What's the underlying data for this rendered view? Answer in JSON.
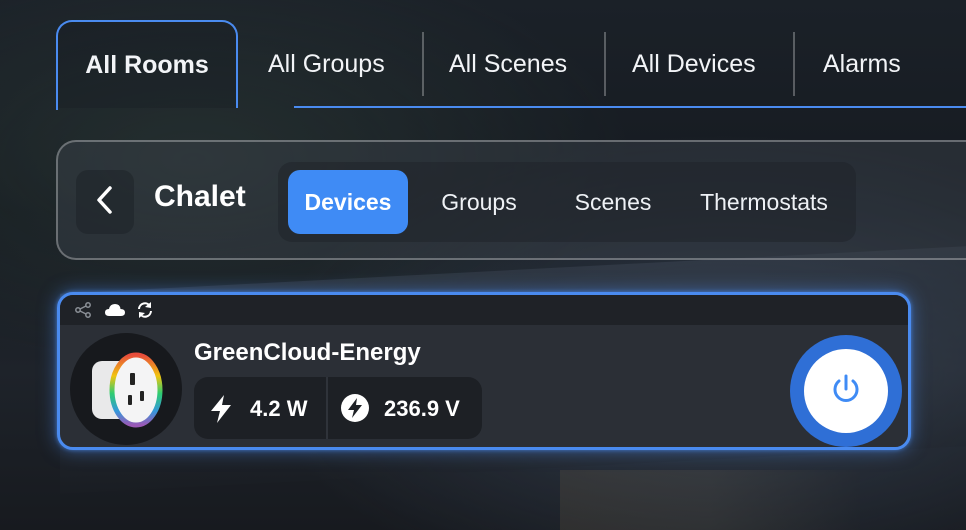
{
  "top_tabs": [
    {
      "label": "All Rooms",
      "active": true
    },
    {
      "label": "All Groups",
      "active": false
    },
    {
      "label": "All Scenes",
      "active": false
    },
    {
      "label": "All Devices",
      "active": false
    },
    {
      "label": "Alarms",
      "active": false
    }
  ],
  "room": {
    "title": "Chalet",
    "back_icon": "chevron-left-icon",
    "sub_tabs": [
      {
        "label": "Devices",
        "active": true
      },
      {
        "label": "Groups",
        "active": false
      },
      {
        "label": "Scenes",
        "active": false
      },
      {
        "label": "Thermostats",
        "active": false
      }
    ]
  },
  "device": {
    "name": "GreenCloud-Energy",
    "status_icons": [
      "share-icon",
      "cloud-icon",
      "refresh-icon"
    ],
    "power_value": "4.2 W",
    "voltage_value": "236.9 V",
    "power_state": "on"
  },
  "colors": {
    "accent": "#4a8bf0",
    "active_tab": "#3f8bf5",
    "power_button": "#2f6fd6"
  }
}
